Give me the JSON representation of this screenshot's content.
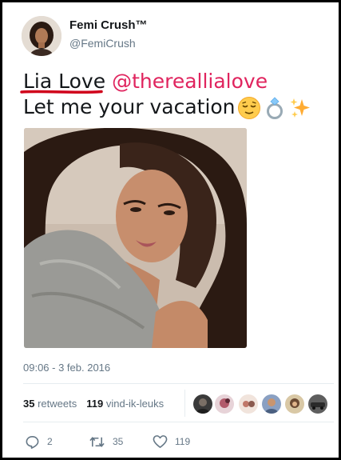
{
  "user": {
    "display_name": "Femi Crush™",
    "handle": "@FemiCrush",
    "avatar_icon": "profile-photo"
  },
  "tweet": {
    "name_text": "Lia Love",
    "mention": "@thereallialove",
    "line2": "Let me your vacation",
    "emojis": [
      "relieved-face",
      "ring",
      "sparkles"
    ],
    "mention_color": "#e0245e",
    "underline_color": "#d0021b"
  },
  "timestamp": "09:06 - 3 feb. 2016",
  "stats": {
    "retweets_count": "35",
    "retweets_label": "retweets",
    "likes_count": "119",
    "likes_label": "vind-ik-leuks"
  },
  "likers": [
    "avatar-1",
    "avatar-2",
    "avatar-3",
    "avatar-4",
    "avatar-5",
    "avatar-6"
  ],
  "actions": {
    "replies": "2",
    "retweets": "35",
    "likes": "119"
  }
}
